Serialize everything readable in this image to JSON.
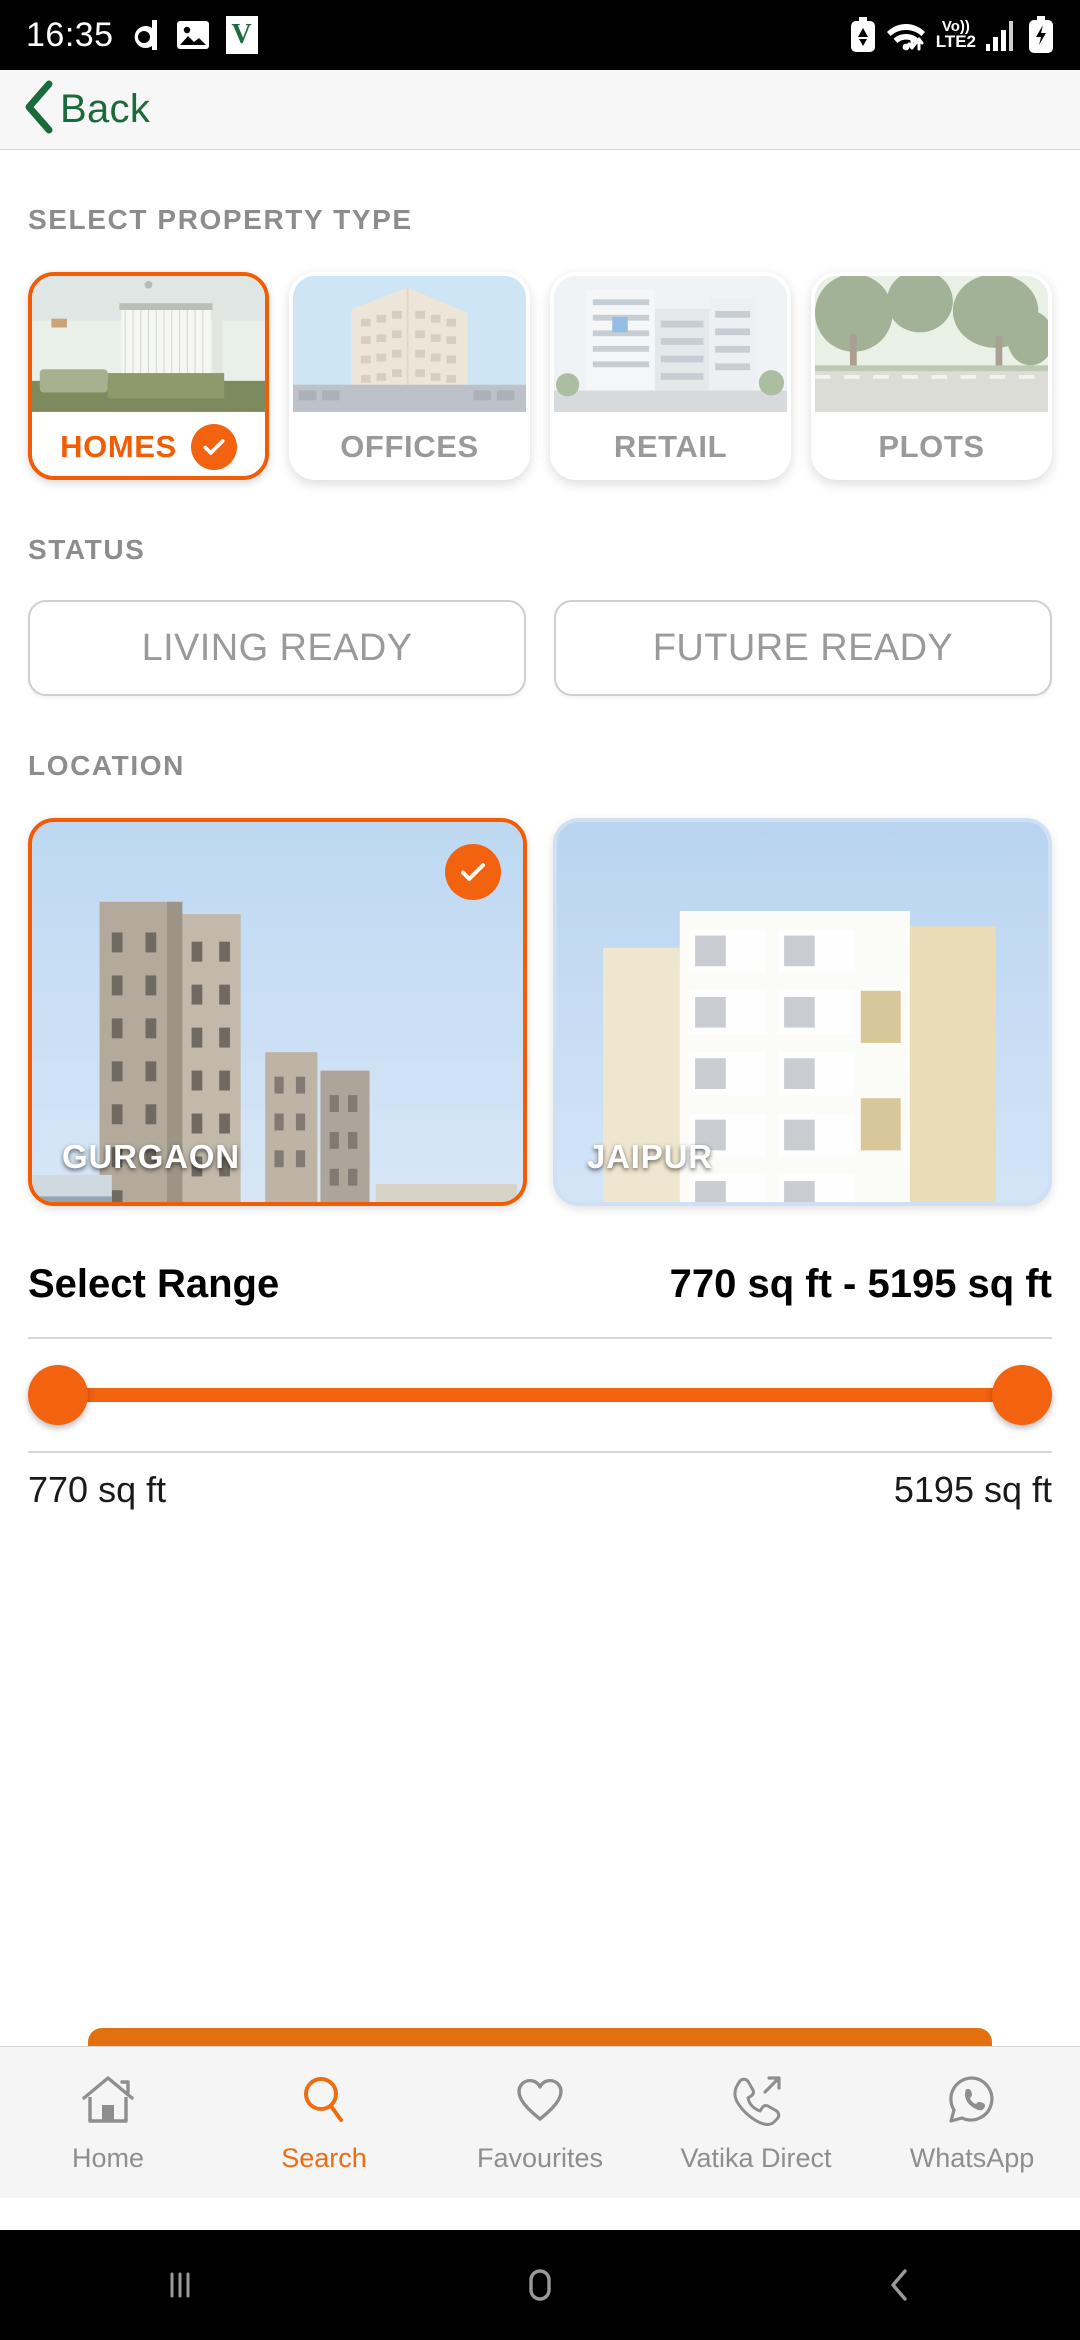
{
  "status_bar": {
    "time": "16:35",
    "left_icons": [
      "dailyhunt-icon",
      "gallery-icon",
      "vatika-v-icon"
    ],
    "network_label": "LTE2",
    "volte_label": "Vo))",
    "right_icons": [
      "data-saver-icon",
      "wifi-icon",
      "volte-lte-icon",
      "signal-bars-icon",
      "battery-charging-icon"
    ]
  },
  "appbar": {
    "back_label": "Back",
    "back_icon": "chevron-left-icon"
  },
  "sections": {
    "property_type_heading": "SELECT PROPERTY TYPE",
    "status_heading": "STATUS",
    "location_heading": "LOCATION"
  },
  "property_types": [
    {
      "label": "HOMES",
      "selected": true,
      "art": "bedroom"
    },
    {
      "label": "OFFICES",
      "selected": false,
      "art": "officetower"
    },
    {
      "label": "RETAIL",
      "selected": false,
      "art": "retail"
    },
    {
      "label": "PLOTS",
      "selected": false,
      "art": "plots"
    }
  ],
  "status_options": [
    {
      "label": "LIVING READY",
      "selected": false
    },
    {
      "label": "FUTURE READY",
      "selected": false
    }
  ],
  "locations": [
    {
      "label": "GURGAON",
      "selected": true,
      "art": "gurgaon"
    },
    {
      "label": "JAIPUR",
      "selected": false,
      "art": "jaipur"
    }
  ],
  "range": {
    "title": "Select Range",
    "value": "770 sq ft - 5195 sq ft",
    "min_label": "770 sq ft",
    "max_label": "5195 sq ft",
    "min": 770,
    "max": 5195
  },
  "bottom_nav": [
    {
      "label": "Home",
      "icon": "home-icon",
      "active": false
    },
    {
      "label": "Search",
      "icon": "search-icon",
      "active": true
    },
    {
      "label": "Favourites",
      "icon": "heart-icon",
      "active": false
    },
    {
      "label": "Vatika Direct",
      "icon": "call-out-icon",
      "active": false
    },
    {
      "label": "WhatsApp",
      "icon": "whatsapp-icon",
      "active": false
    }
  ],
  "android_nav": [
    "recents-icon",
    "home-circle-icon",
    "back-chevron-icon"
  ],
  "colors": {
    "accent": "#f2620f",
    "back_green": "#1a6b3c",
    "heading_grey": "#8d8d8d",
    "nav_grey": "#8e8e8e"
  }
}
